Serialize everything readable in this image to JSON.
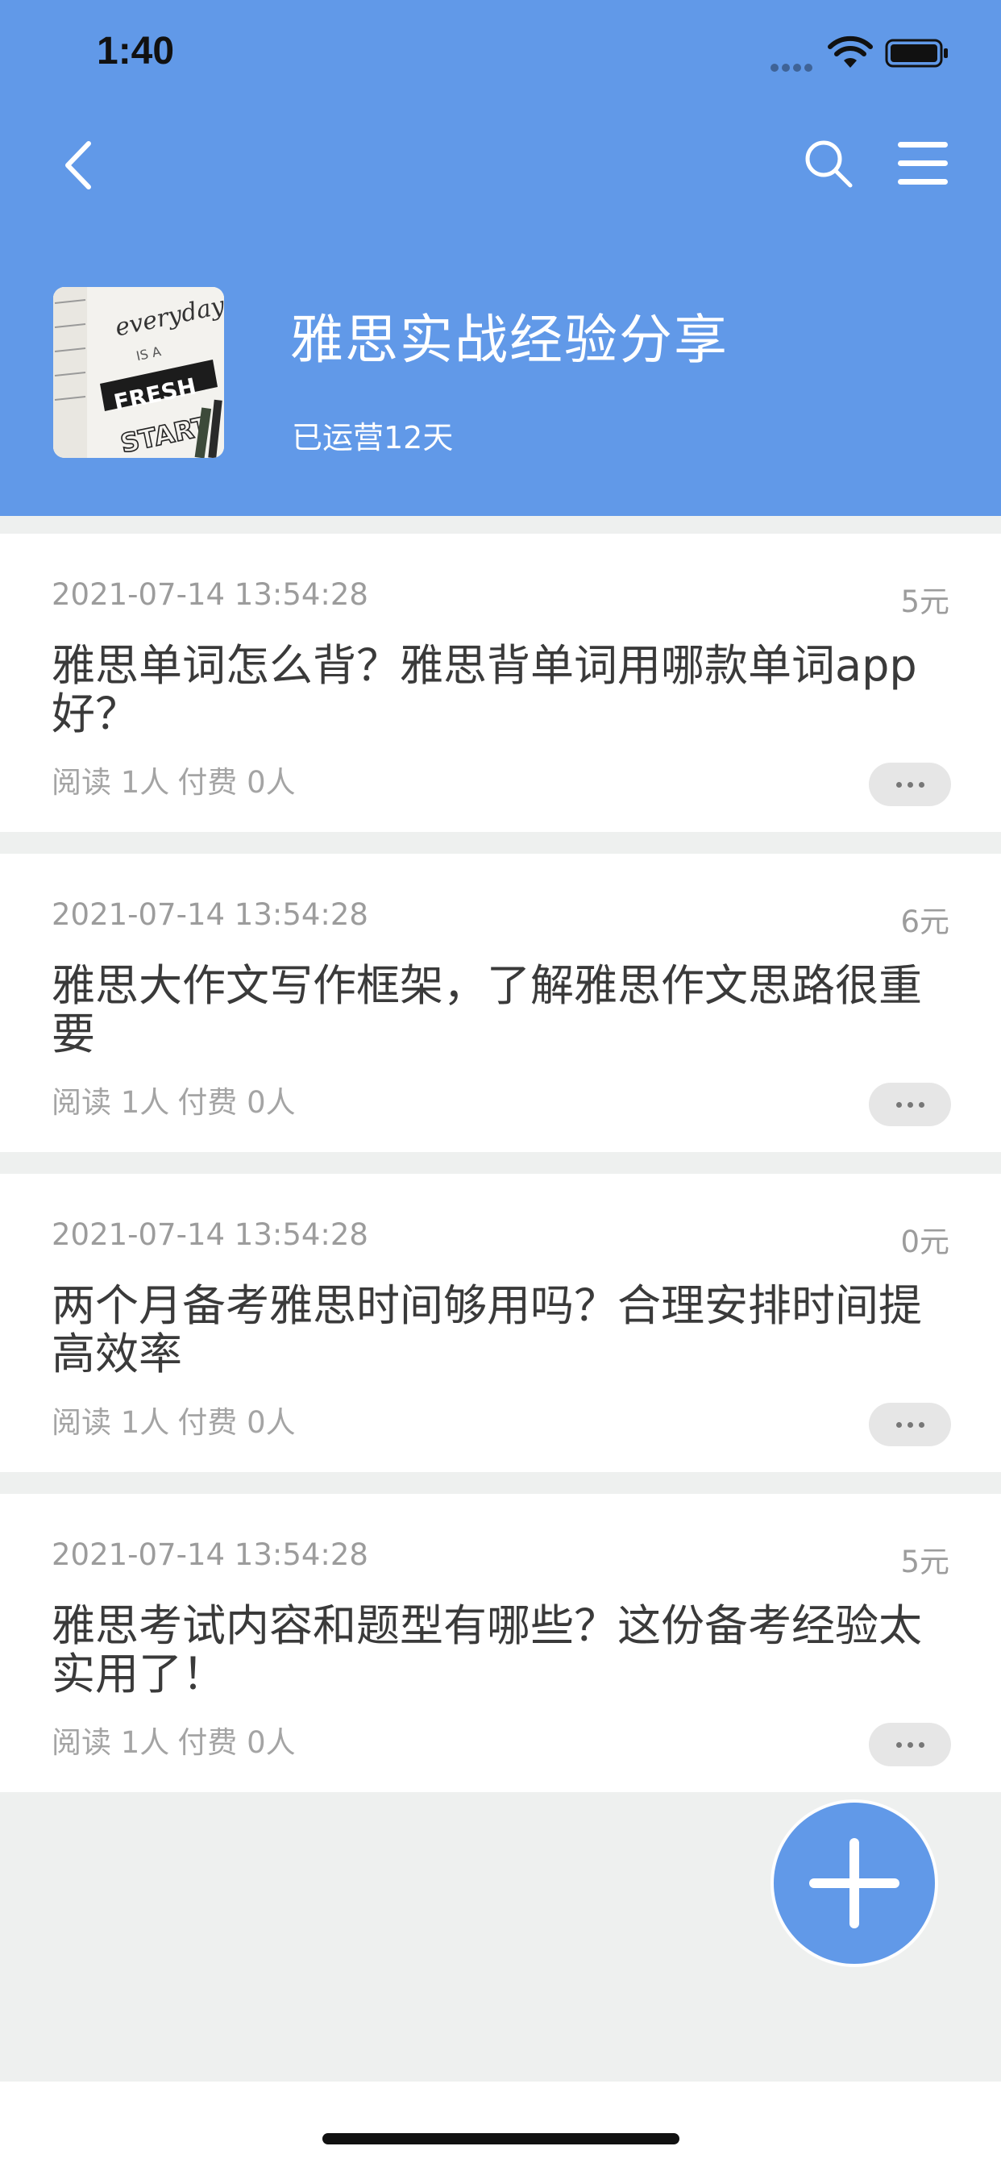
{
  "status_bar": {
    "time": "1:40"
  },
  "nav": {
    "back_icon": "chevron-left-icon",
    "search_icon": "search-icon",
    "menu_icon": "menu-icon"
  },
  "group": {
    "title": "雅思实战经验分享",
    "subtitle": "已运营12天",
    "cover_text": [
      "everyday",
      "IS A",
      "FRESH",
      "START"
    ]
  },
  "posts": [
    {
      "date": "2021-07-14 13:54:28",
      "price": "5元",
      "title": "雅思单词怎么背？雅思背单词用哪款单词app好？",
      "reads": "阅读 1人",
      "paid": "付费 0人"
    },
    {
      "date": "2021-07-14 13:54:28",
      "price": "6元",
      "title": "雅思大作文写作框架，了解雅思作文思路很重要",
      "reads": "阅读 1人",
      "paid": "付费 0人"
    },
    {
      "date": "2021-07-14 13:54:28",
      "price": "0元",
      "title": "两个月备考雅思时间够用吗？合理安排时间提高效率",
      "reads": "阅读 1人",
      "paid": "付费 0人"
    },
    {
      "date": "2021-07-14 13:54:28",
      "price": "5元",
      "title": "雅思考试内容和题型有哪些？这份备考经验太实用了！",
      "reads": "阅读 1人",
      "paid": "付费 0人"
    }
  ],
  "colors": {
    "header": "#6199e8",
    "background": "#eef0ef",
    "fab": "#6199e8"
  }
}
